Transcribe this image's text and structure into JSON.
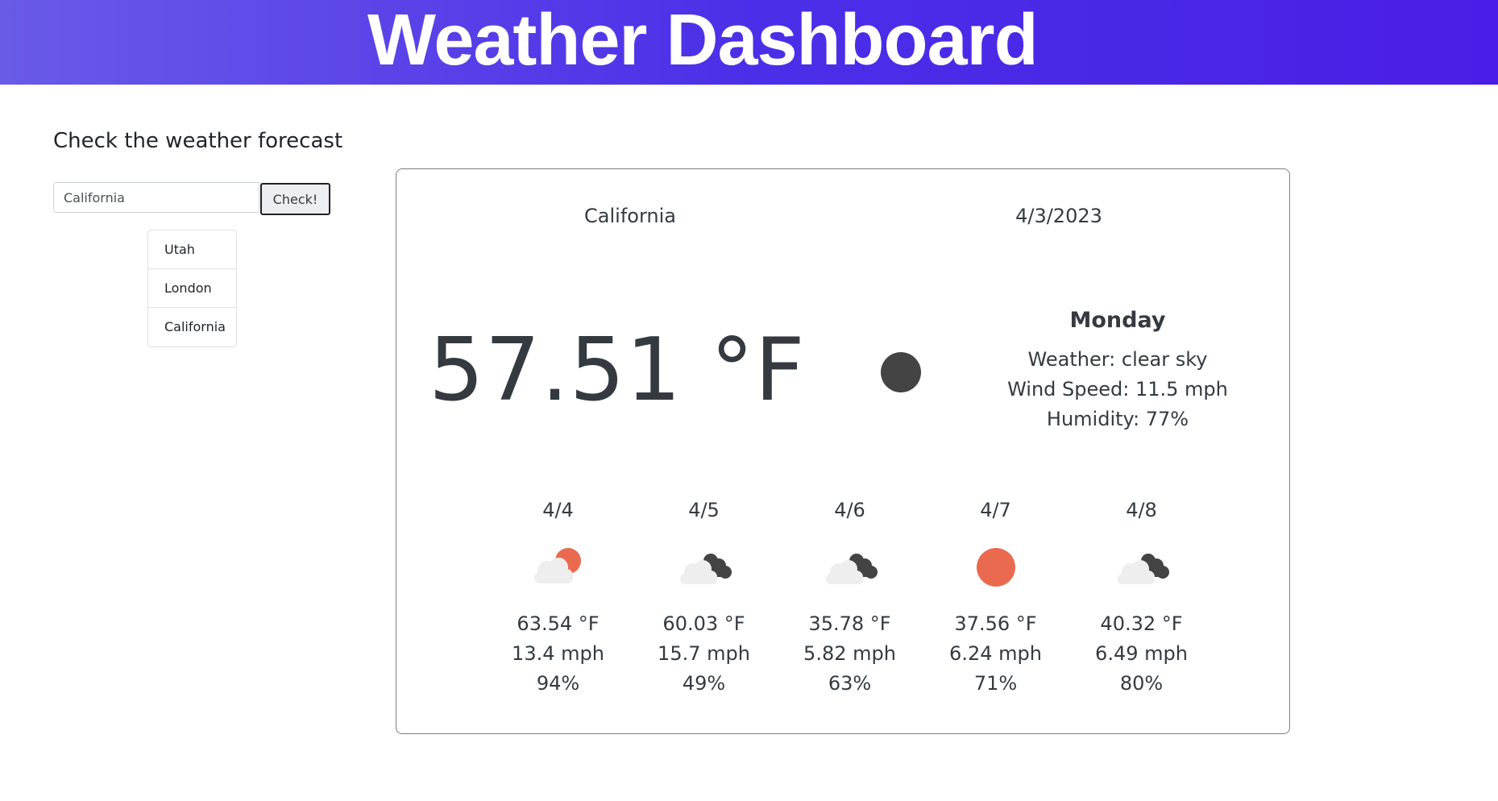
{
  "header": {
    "title": "Weather Dashboard"
  },
  "search": {
    "heading": "Check the weather forecast",
    "input_value": "California",
    "button_label": "Check!"
  },
  "history": [
    "Utah",
    "London",
    "California"
  ],
  "current": {
    "city": "California",
    "date": "4/3/2023",
    "temperature": "57.51 °F",
    "day": "Monday",
    "weather": "Weather: clear sky",
    "wind": "Wind Speed: 11.5 mph",
    "humidity": "Humidity: 77%",
    "icon": "clear-night-icon"
  },
  "forecast": [
    {
      "date": "4/4",
      "icon": "partly-cloudy-day-icon",
      "temp": "63.54 °F",
      "wind": "13.4 mph",
      "humidity": "94%"
    },
    {
      "date": "4/5",
      "icon": "cloudy-icon",
      "temp": "60.03 °F",
      "wind": "15.7 mph",
      "humidity": "49%"
    },
    {
      "date": "4/6",
      "icon": "cloudy-icon",
      "temp": "35.78 °F",
      "wind": "5.82 mph",
      "humidity": "63%"
    },
    {
      "date": "4/7",
      "icon": "sun-icon",
      "temp": "37.56 °F",
      "wind": "6.24 mph",
      "humidity": "71%"
    },
    {
      "date": "4/8",
      "icon": "cloudy-icon",
      "temp": "40.32 °F",
      "wind": "6.49 mph",
      "humidity": "80%"
    }
  ],
  "colors": {
    "header_start": "#6a5ae8",
    "header_end": "#4a1ee6",
    "sun": "#ea6a4f",
    "dark_cloud": "#444444",
    "light_cloud": "#eeeeee"
  }
}
